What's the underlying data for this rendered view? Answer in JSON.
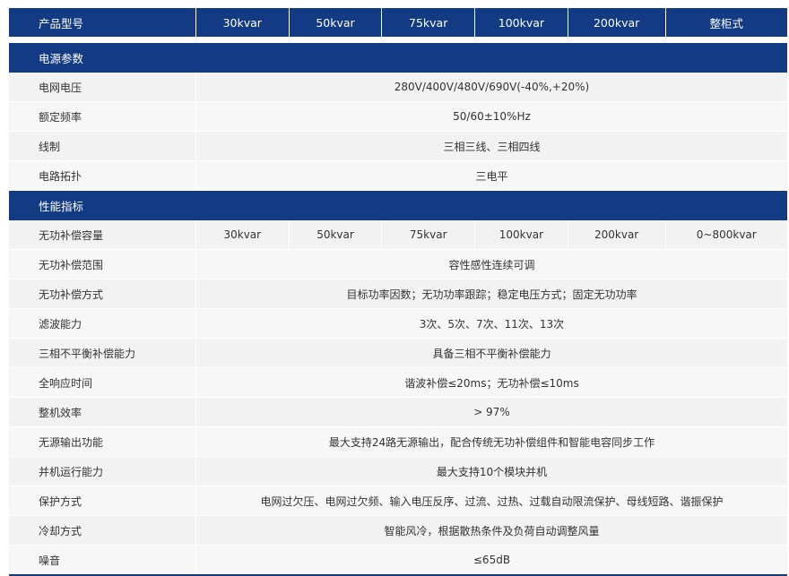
{
  "header": {
    "label": "产品型号",
    "models": [
      "30kvar",
      "50kvar",
      "75kvar",
      "100kvar",
      "200kvar",
      "整柜式"
    ]
  },
  "sections": [
    {
      "title": "电源参数",
      "rows": [
        {
          "label": "电网电压",
          "value": "280V/400V/480V/690V(-40%,+20%)"
        },
        {
          "label": "额定频率",
          "value": "50/60±10%Hz"
        },
        {
          "label": "线制",
          "value": "三相三线、三相四线"
        },
        {
          "label": "电路拓扑",
          "value": "三电平"
        }
      ]
    },
    {
      "title": "性能指标",
      "capacity": {
        "label": "无功补偿容量",
        "values": [
          "30kvar",
          "50kvar",
          "75kvar",
          "100kvar",
          "200kvar",
          "0~800kvar"
        ]
      },
      "rows": [
        {
          "label": "无功补偿范围",
          "value": "容性感性连续可调"
        },
        {
          "label": "无功补偿方式",
          "value": "目标功率因数；无功功率跟踪；稳定电压方式；固定无功功率"
        },
        {
          "label": "滤波能力",
          "value": "3次、5次、7次、11次、13次"
        },
        {
          "label": "三相不平衡补偿能力",
          "value": "具备三相不平衡补偿能力"
        },
        {
          "label": "全响应时间",
          "value": "谐波补偿≤20ms；无功补偿≤10ms"
        },
        {
          "label": "整机效率",
          "value": "> 97%"
        },
        {
          "label": "无源输出功能",
          "value": "最大支持24路无源输出，配合传统无功补偿组件和智能电容同步工作"
        },
        {
          "label": "并机运行能力",
          "value": "最大支持10个模块并机"
        },
        {
          "label": "保护方式",
          "value": "电网过欠压、电网过欠频、输入电压反序、过流、过热、过载自动限流保护、母线短路、谐振保护"
        },
        {
          "label": "冷却方式",
          "value": "智能风冷，根据散热条件及负荷自动调整风量"
        },
        {
          "label": "噪音",
          "value": "≤65dB"
        }
      ]
    }
  ],
  "colors": {
    "header_bg": "#133b83",
    "row_odd": "#f2f2f2",
    "row_even": "#f7f7f7"
  }
}
